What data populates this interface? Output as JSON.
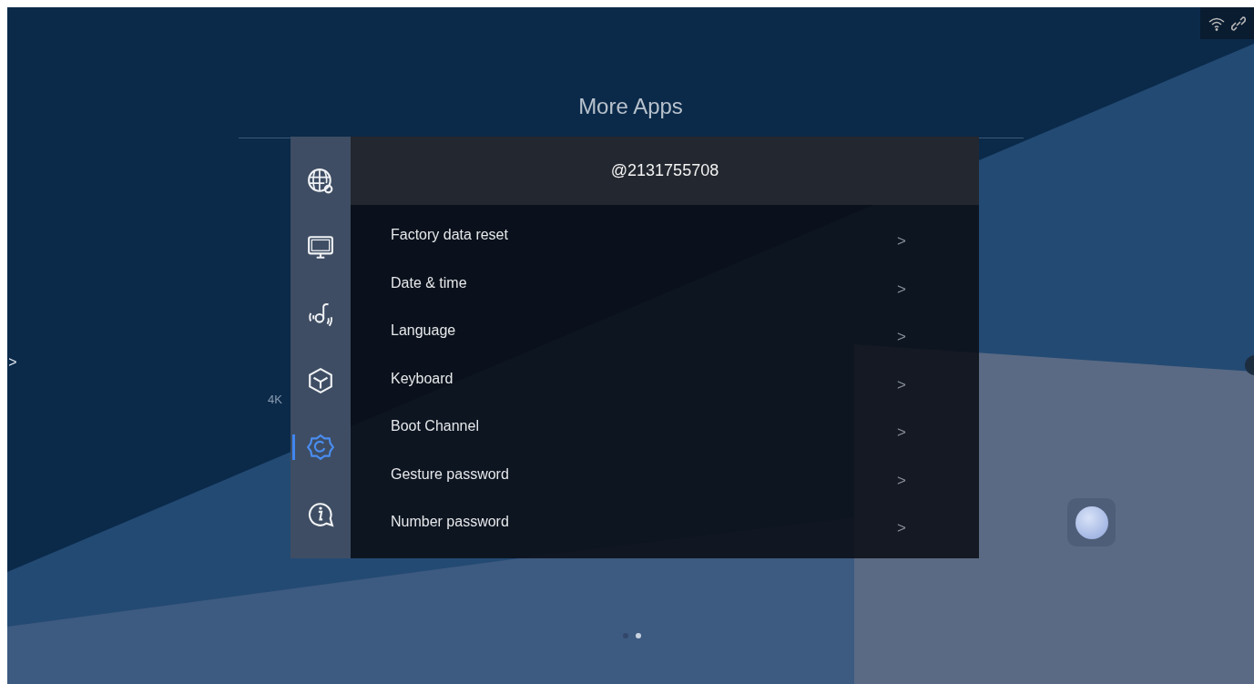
{
  "status_icons": [
    {
      "kind": "wifi"
    },
    {
      "kind": "link"
    }
  ],
  "page_title": "More Apps",
  "background_labels": [
    "4K"
  ],
  "settings_panel": {
    "account": "@2131755708",
    "sidebar_items": [
      {
        "kind": "network",
        "selected": false
      },
      {
        "kind": "display",
        "selected": false
      },
      {
        "kind": "sound",
        "selected": false
      },
      {
        "kind": "apps",
        "selected": false
      },
      {
        "kind": "system",
        "selected": true
      },
      {
        "kind": "about",
        "selected": false
      }
    ],
    "rows": [
      {
        "label": "Factory data reset",
        "chevron": ">"
      },
      {
        "label": "Date & time",
        "chevron": ">"
      },
      {
        "label": "Language",
        "chevron": ">"
      },
      {
        "label": "Keyboard",
        "chevron": ">"
      },
      {
        "label": "Boot Channel",
        "chevron": ">"
      },
      {
        "label": "Gesture password",
        "chevron": ">"
      },
      {
        "label": "Number password",
        "chevron": ">"
      }
    ]
  },
  "left_handle": ">",
  "page_dots": [
    {
      "selected": false
    },
    {
      "selected": true
    }
  ]
}
